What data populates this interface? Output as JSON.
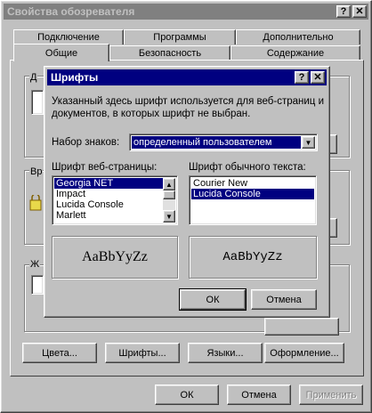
{
  "window": {
    "title": "Свойства обозревателя",
    "help_glyph": "?",
    "close_glyph": "✕",
    "tabs_back": [
      "Подключение",
      "Программы",
      "Дополнительно"
    ],
    "tabs_front": [
      "Общие",
      "Безопасность",
      "Содержание"
    ],
    "behind_letters": [
      "Д",
      "Вр",
      "Ж"
    ],
    "bottom_buttons": [
      "Цвета...",
      "Шрифты...",
      "Языки...",
      "Оформление..."
    ],
    "footer_buttons": {
      "ok": "ОК",
      "cancel": "Отмена",
      "apply": "Применить"
    }
  },
  "dialog": {
    "title": "Шрифты",
    "help_glyph": "?",
    "close_glyph": "✕",
    "description": "Указанный здесь шрифт используется для веб-страниц и документов, в которых шрифт не выбран.",
    "charset_label": "Набор знаков:",
    "charset_value": "определенный пользователем",
    "web_font_label": "Шрифт веб-страницы:",
    "web_fonts": [
      "Georgia NET",
      "Impact",
      "Lucida Console",
      "Marlett"
    ],
    "plain_font_label": "Шрифт обычного текста:",
    "plain_fonts": [
      "Courier New",
      "Lucida Console"
    ],
    "preview_text_left": "AaBbYyZz",
    "preview_text_right": "AaBbYyZz",
    "ok": "ОК",
    "cancel": "Отмена"
  }
}
